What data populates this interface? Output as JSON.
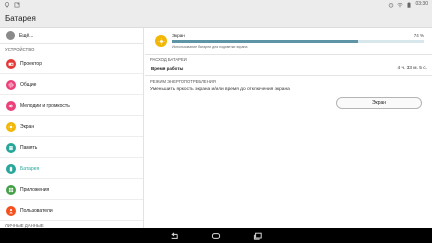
{
  "status_bar": {
    "left_icons": [
      "bulb-icon",
      "notification-icon"
    ],
    "right_icons": [
      "alarm-icon",
      "wifi-icon",
      "battery-icon"
    ],
    "time": "03:30"
  },
  "app_bar": {
    "title": "Батарея"
  },
  "sidebar": {
    "account_label": "Ещё...",
    "section_device": "УСТРОЙСТВО",
    "items": [
      {
        "label": "Проектор",
        "icon": "projector-icon",
        "color": "#e53935"
      },
      {
        "label": "Общие",
        "icon": "settings-icon",
        "color": "#ec407a"
      },
      {
        "label": "Мелодии и громкость",
        "icon": "volume-icon",
        "color": "#ec407a"
      },
      {
        "label": "Экран",
        "icon": "brightness-icon",
        "color": "#f2b705"
      },
      {
        "label": "Память",
        "icon": "storage-icon",
        "color": "#26a69a"
      },
      {
        "label": "Батарея",
        "icon": "battery-icon",
        "color": "#26a69a"
      },
      {
        "label": "Приложения",
        "icon": "apps-icon",
        "color": "#43a047"
      },
      {
        "label": "Пользователи",
        "icon": "users-icon",
        "color": "#f4511e"
      }
    ],
    "section_personal": "ЛИЧНЫЕ ДАННЫЕ",
    "active_item": "Батарея",
    "accent_color": "#26a69a"
  },
  "main": {
    "usage": {
      "name": "Экран",
      "percent": "74 %",
      "percent_value": 0.74,
      "caption": "Использование батареи для подсветки экрана",
      "icon": "brightness-icon",
      "bar_color": "#5d95a6"
    },
    "battery_usage_section": "РАСХОД БАТАРЕИ",
    "runtime_label": "Время работы",
    "runtime_value": "4 ч. 33 м. 5 с.",
    "power_mode_section": "РЕЖИМ ЭНЕРГОПОТРЕБЛЕНИЯ",
    "power_mode_desc": "Уменьшить яркость экрана и/или время до отключения экрана",
    "screen_button": "Экран"
  },
  "nav_bar": {
    "buttons": [
      "back-icon",
      "home-icon",
      "recents-icon"
    ]
  }
}
